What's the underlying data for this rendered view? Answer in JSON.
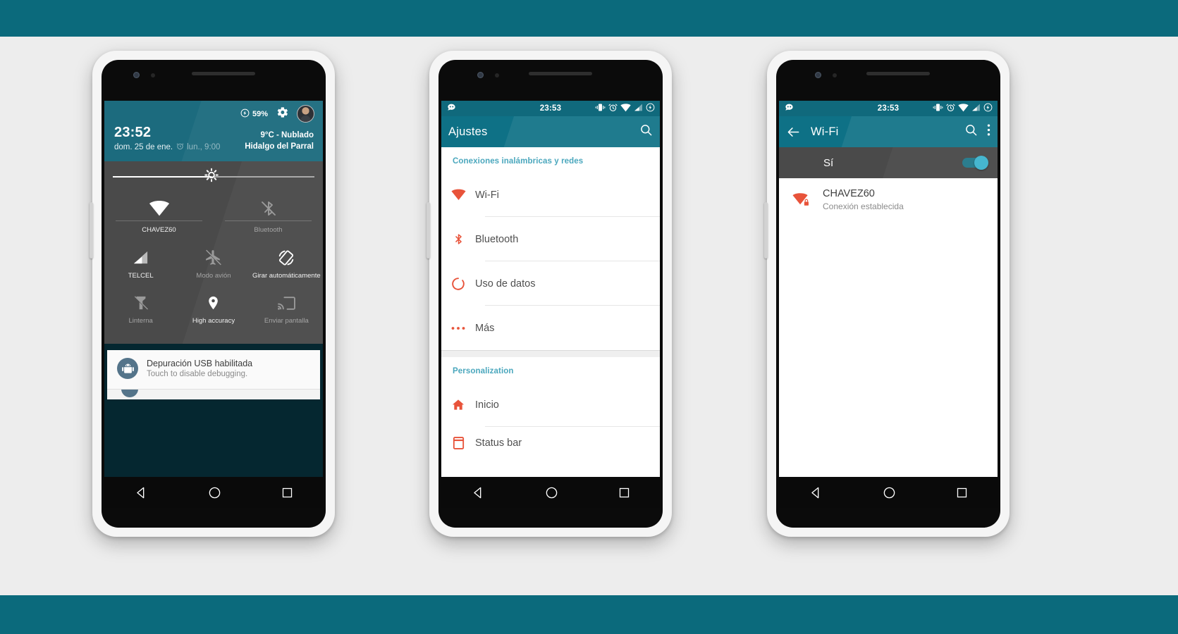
{
  "background": {
    "band_color": "#0b6a7c",
    "page_color": "#ededed"
  },
  "phone1": {
    "name": "quick-settings-phone",
    "quick_settings": {
      "battery_percent": "59%",
      "battery_icon": "charging-bolt-icon",
      "settings_icon": "gear-icon",
      "avatar_icon": "user-avatar",
      "time": "23:52",
      "date": "dom. 25 de ene.",
      "alarm_icon": "alarm-clock-icon",
      "alarm_time": "lun., 9:00",
      "weather_temp": "9°C - Nublado",
      "weather_location": "Hidalgo del Parral",
      "brightness_icon": "brightness-icon",
      "brightness_value": 49,
      "tiles_row1": [
        {
          "label": "CHAVEZ60",
          "icon": "wifi-icon",
          "state": "on"
        },
        {
          "label": "Bluetooth",
          "icon": "bluetooth-off-icon",
          "state": "off"
        }
      ],
      "tiles_row2": [
        {
          "label": "TELCEL",
          "icon": "signal-bars-icon",
          "state": "on"
        },
        {
          "label": "Modo avión",
          "icon": "airplane-off-icon",
          "state": "off"
        },
        {
          "label": "Girar automáticamente",
          "icon": "auto-rotate-icon",
          "state": "on"
        }
      ],
      "tiles_row3": [
        {
          "label": "Linterna",
          "icon": "flashlight-off-icon",
          "state": "off"
        },
        {
          "label": "High accuracy",
          "icon": "location-pin-icon",
          "state": "on"
        },
        {
          "label": "Enviar pantalla",
          "icon": "cast-screen-icon",
          "state": "off"
        }
      ]
    },
    "notification": {
      "icon": "android-robot-icon",
      "title": "Depuración USB habilitada",
      "subtitle": "Touch to disable debugging."
    },
    "navbar": {
      "back": "back-triangle-icon",
      "home": "home-circle-icon",
      "recents": "recents-square-icon"
    }
  },
  "phone2": {
    "name": "settings-phone",
    "statusbar": {
      "logo_icon": "cyanogenmod-icon",
      "time": "23:53",
      "icons": [
        "vibrate-icon",
        "alarm-clock-icon",
        "wifi-icon",
        "signal-icon",
        "battery-icon"
      ]
    },
    "appbar": {
      "title": "Ajustes",
      "search_icon": "search-icon"
    },
    "sections": [
      {
        "header": "Conexiones inalámbricas y redes",
        "items": [
          {
            "label": "Wi-Fi",
            "icon": "wifi-icon"
          },
          {
            "label": "Bluetooth",
            "icon": "bluetooth-icon"
          },
          {
            "label": "Uso de datos",
            "icon": "data-usage-icon"
          },
          {
            "label": "Más",
            "icon": "more-dots-icon"
          }
        ]
      },
      {
        "header": "Personalization",
        "items": [
          {
            "label": "Inicio",
            "icon": "home-icon"
          },
          {
            "label": "Status bar",
            "icon": "status-bar-icon"
          }
        ]
      }
    ],
    "navbar": {
      "back": "back-triangle-icon",
      "home": "home-circle-icon",
      "recents": "recents-square-icon"
    }
  },
  "phone3": {
    "name": "wifi-settings-phone",
    "statusbar": {
      "logo_icon": "cyanogenmod-icon",
      "time": "23:53",
      "icons": [
        "vibrate-icon",
        "alarm-clock-icon",
        "wifi-icon",
        "signal-icon",
        "battery-icon"
      ]
    },
    "appbar": {
      "back_icon": "arrow-back-icon",
      "title": "Wi-Fi",
      "search_icon": "search-icon",
      "overflow_icon": "overflow-menu-icon"
    },
    "toggle": {
      "label": "Sí",
      "state": "on",
      "accent": "#46b6cf"
    },
    "networks": [
      {
        "ssid": "CHAVEZ60",
        "status": "Conexión establecida",
        "icon": "wifi-secured-icon"
      }
    ],
    "navbar": {
      "back": "back-triangle-icon",
      "home": "home-circle-icon",
      "recents": "recents-square-icon"
    }
  }
}
